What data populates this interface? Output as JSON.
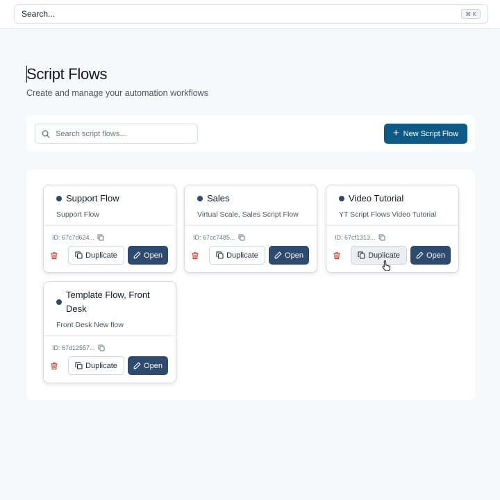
{
  "topbar": {
    "search_label": "Search...",
    "shortcut": "⌘ K"
  },
  "header": {
    "title": "Script Flows",
    "subtitle": "Create and manage your automation workflows"
  },
  "toolbar": {
    "search_placeholder": "Search script flows...",
    "new_button_label": "New Script Flow"
  },
  "cards": [
    {
      "title": "Support Flow",
      "description": "Support Flow",
      "id": "ID: 67c7d624...",
      "duplicate_label": "Duplicate",
      "open_label": "Open"
    },
    {
      "title": "Sales",
      "description": "Virtual Scale, Sales Script Flow",
      "id": "ID: 67cc7485...",
      "duplicate_label": "Duplicate",
      "open_label": "Open"
    },
    {
      "title": "Video Tutorial",
      "description": "YT Script Flows Video Tutorial",
      "id": "ID: 67cf1313...",
      "duplicate_label": "Duplicate",
      "open_label": "Open"
    },
    {
      "title": "Template Flow, Front Desk",
      "description": "Front Desk New flow",
      "id": "ID: 67d12557...",
      "duplicate_label": "Duplicate",
      "open_label": "Open"
    }
  ],
  "colors": {
    "primary": "#0e5a84",
    "open_button": "#2e4a6e",
    "delete_icon": "#c0392b"
  }
}
